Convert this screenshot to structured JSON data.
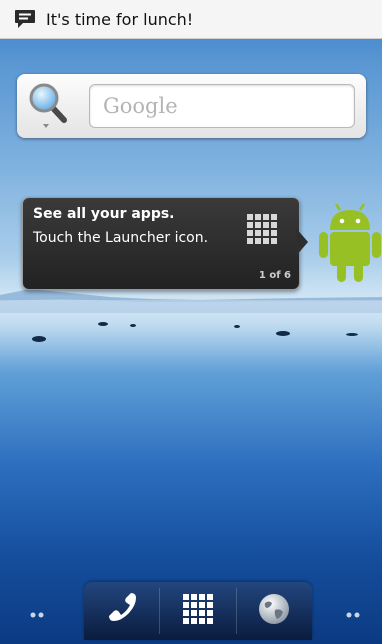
{
  "status_bar": {
    "notification_icon": "chat-bubble-icon",
    "notification_text": "It's time for lunch!"
  },
  "search_widget": {
    "icon": "magnifier-icon",
    "placeholder": "Google"
  },
  "tooltip": {
    "title": "See all your apps.",
    "body": "Touch the Launcher icon.",
    "page_indicator": "1 of 6",
    "icon": "app-grid-icon"
  },
  "mascot": {
    "icon": "android-robot-icon"
  },
  "dock": {
    "buttons": [
      {
        "name": "phone",
        "icon": "phone-icon"
      },
      {
        "name": "launcher",
        "icon": "app-grid-icon"
      },
      {
        "name": "browser",
        "icon": "globe-icon"
      }
    ]
  },
  "colors": {
    "status_bar_bg": "#f5f5f5",
    "tooltip_bg": "#2b2b2b",
    "android_green": "#97c024"
  }
}
